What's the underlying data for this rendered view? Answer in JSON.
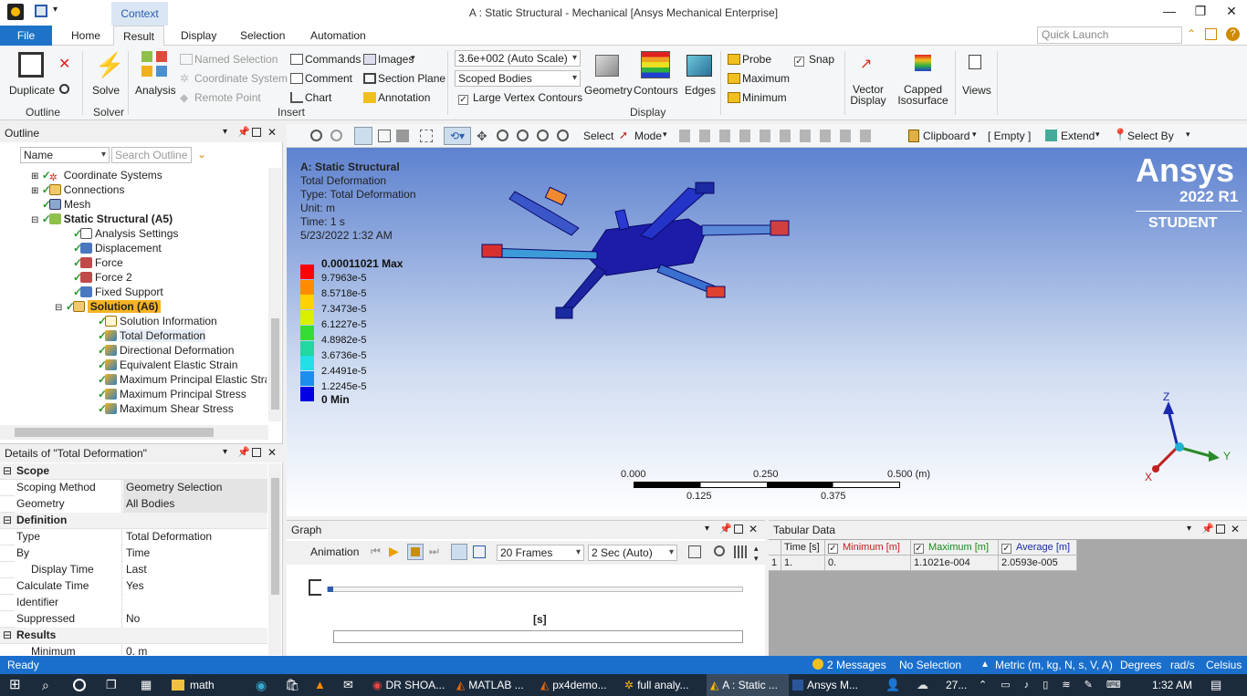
{
  "titlebar": {
    "title": "A : Static Structural - Mechanical [Ansys Mechanical Enterprise]",
    "context_tab": "Context"
  },
  "tabs": {
    "file": "File",
    "items": [
      "Home",
      "Result",
      "Display",
      "Selection",
      "Automation"
    ],
    "active": "Result",
    "quick_launch_placeholder": "Quick Launch"
  },
  "ribbon": {
    "outline_group": "Outline",
    "duplicate": "Duplicate",
    "solve": "Solve",
    "solver_group": "Solver",
    "analysis": "Analysis",
    "named_selection": "Named Selection",
    "coordinate_system": "Coordinate System",
    "remote_point": "Remote Point",
    "commands": "Commands",
    "comment": "Comment",
    "chart": "Chart",
    "images": "Images",
    "section_plane": "Section Plane",
    "annotation": "Annotation",
    "insert_group": "Insert",
    "scale_value": "3.6e+002 (Auto Scale)",
    "scope_value": "Scoped Bodies",
    "large_vertex_contours": "Large Vertex Contours",
    "geometry": "Geometry",
    "contours": "Contours",
    "edges": "Edges",
    "display_group": "Display",
    "probe": "Probe",
    "maximum": "Maximum",
    "minimum": "Minimum",
    "snap": "Snap",
    "vector_display": "Vector Display",
    "capped_isosurface": "Capped Isosurface",
    "views": "Views"
  },
  "toolbar": {
    "select": "Select",
    "mode": "Mode",
    "clipboard": "Clipboard",
    "empty": "[ Empty ]",
    "extend": "Extend",
    "select_by": "Select By"
  },
  "outline": {
    "title": "Outline",
    "name_filter": "Name",
    "search_placeholder": "Search Outline",
    "items": [
      {
        "label": "Coordinate Systems",
        "indent": 1
      },
      {
        "label": "Connections",
        "indent": 1
      },
      {
        "label": "Mesh",
        "indent": 1
      },
      {
        "label": "Static Structural (A5)",
        "indent": 1
      },
      {
        "label": "Analysis Settings",
        "indent": 2
      },
      {
        "label": "Displacement",
        "indent": 2
      },
      {
        "label": "Force",
        "indent": 2
      },
      {
        "label": "Force 2",
        "indent": 2
      },
      {
        "label": "Fixed Support",
        "indent": 2
      },
      {
        "label": "Solution (A6)",
        "indent": 2
      },
      {
        "label": "Solution Information",
        "indent": 3
      },
      {
        "label": "Total Deformation",
        "indent": 3
      },
      {
        "label": "Directional Deformation",
        "indent": 3
      },
      {
        "label": "Equivalent Elastic Strain",
        "indent": 3
      },
      {
        "label": "Maximum Principal Elastic Strain",
        "indent": 3
      },
      {
        "label": "Maximum Principal Stress",
        "indent": 3
      },
      {
        "label": "Maximum Shear Stress",
        "indent": 3
      }
    ]
  },
  "details": {
    "title": "Details of \"Total Deformation\"",
    "rows": [
      {
        "section": "Scope"
      },
      {
        "k": "Scoping Method",
        "v": "Geometry Selection",
        "sel": true
      },
      {
        "k": "Geometry",
        "v": "All Bodies",
        "sel": true
      },
      {
        "section": "Definition"
      },
      {
        "k": "Type",
        "v": "Total Deformation"
      },
      {
        "k": "By",
        "v": "Time"
      },
      {
        "k": "Display Time",
        "v": "Last",
        "check": true
      },
      {
        "k": "Calculate Time History",
        "v": "Yes"
      },
      {
        "k": "Identifier",
        "v": ""
      },
      {
        "k": "Suppressed",
        "v": "No"
      },
      {
        "section": "Results"
      },
      {
        "k": "Minimum",
        "v": "0. m",
        "check": true
      }
    ]
  },
  "viewport": {
    "header": [
      "A: Static Structural",
      "Total Deformation",
      "Type: Total Deformation",
      "Unit: m",
      "Time: 1 s",
      "5/23/2022 1:32 AM"
    ],
    "legend": {
      "max_label": "0.00011021 Max",
      "min_label": "0 Min",
      "levels": [
        "9.7963e-5",
        "8.5718e-5",
        "7.3473e-5",
        "6.1227e-5",
        "4.8982e-5",
        "3.6736e-5",
        "2.4491e-5",
        "1.2245e-5"
      ],
      "colors": [
        "#ff0000",
        "#ff8c00",
        "#ffd200",
        "#d6f000",
        "#33dd33",
        "#20d8a0",
        "#22e0e6",
        "#1a8ff0",
        "#0000e0"
      ]
    },
    "brand": {
      "name": "Ansys",
      "version": "2022 R1",
      "edition": "STUDENT"
    },
    "scale": {
      "t0": "0.000",
      "t1": "0.250",
      "t2": "0.500 (m)",
      "b1": "0.125",
      "b2": "0.375"
    },
    "axes": {
      "z": "Z",
      "y": "Y",
      "x": "X"
    }
  },
  "graph": {
    "title": "Graph",
    "animation": "Animation",
    "frames": "20 Frames",
    "duration": "2 Sec (Auto)",
    "unit": "[s]"
  },
  "tabular": {
    "title": "Tabular Data",
    "headers": [
      "Time [s]",
      "Minimum [m]",
      "Maximum [m]",
      "Average [m]"
    ],
    "row_index": "1",
    "row": [
      "1.",
      "0.",
      "1.1021e-004",
      "2.0593e-005"
    ]
  },
  "status": {
    "ready": "Ready",
    "messages": "2 Messages",
    "selection": "No Selection",
    "units": "Metric (m, kg, N, s, V, A)",
    "degrees": "Degrees",
    "rads": "rad/s",
    "temp": "Celsius"
  },
  "taskbar": {
    "items": [
      "math",
      "DR SHOA...",
      "MATLAB ...",
      "px4demo...",
      "full analy...",
      "A : Static ...",
      "Ansys M..."
    ],
    "weather": "27...",
    "time": "1:32 AM"
  }
}
